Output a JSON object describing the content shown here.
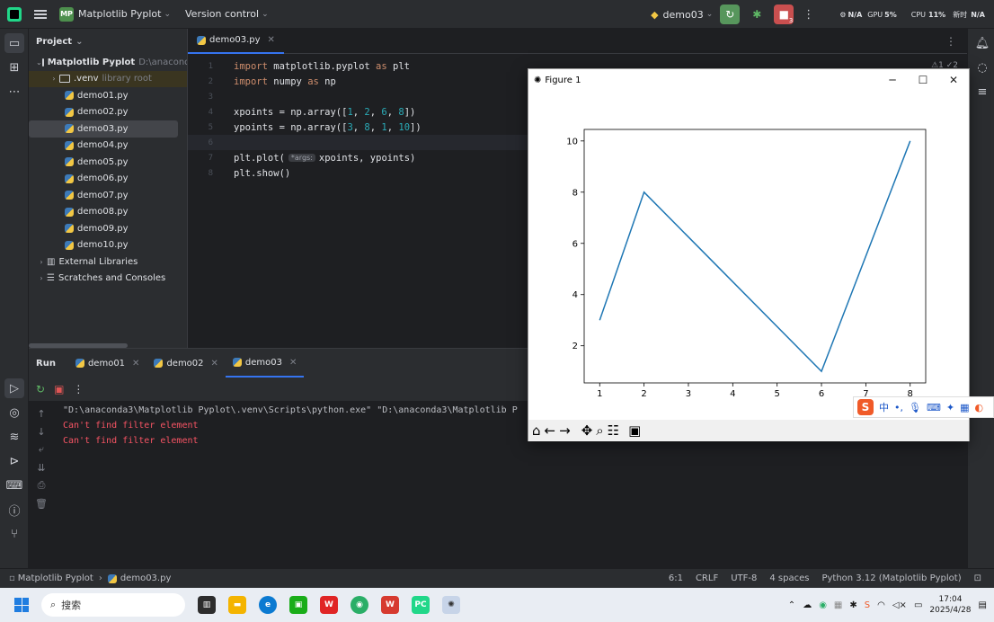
{
  "titlebar": {
    "project_badge": "MP",
    "project_name": "Matplotlib Pyplot",
    "version_control": "Version control",
    "run_config": "demo03",
    "run_badge": "3",
    "gpu": "GPU",
    "gpu_pct": "5%",
    "na1": "N/A",
    "cpu": "CPU",
    "cpu_pct": "11%",
    "net_label": "新时",
    "na2": "N/A"
  },
  "project": {
    "header": "Project",
    "root": {
      "name": "Matplotlib Pyplot",
      "path": "D:\\anacond"
    },
    "venv": {
      "name": ".venv",
      "note": "library root"
    },
    "files": [
      "demo01.py",
      "demo02.py",
      "demo03.py",
      "demo04.py",
      "demo05.py",
      "demo06.py",
      "demo07.py",
      "demo08.py",
      "demo09.py",
      "demo10.py"
    ],
    "selected_index": 2,
    "external": "External Libraries",
    "scratches": "Scratches and Consoles"
  },
  "editor": {
    "tab": "demo03.py",
    "inspect": "⚠1 ✓2",
    "lines": [
      {
        "n": "1",
        "parts": [
          [
            "kw",
            "import"
          ],
          [
            "t",
            " matplotlib.pyplot "
          ],
          [
            "kw",
            "as"
          ],
          [
            "t",
            " plt"
          ]
        ]
      },
      {
        "n": "2",
        "parts": [
          [
            "kw",
            "import"
          ],
          [
            "t",
            " numpy "
          ],
          [
            "kw",
            "as"
          ],
          [
            "t",
            " np"
          ]
        ]
      },
      {
        "n": "3",
        "parts": []
      },
      {
        "n": "4",
        "parts": [
          [
            "t",
            "xpoints = np.array(["
          ],
          [
            "num",
            "1"
          ],
          [
            "t",
            ", "
          ],
          [
            "num",
            "2"
          ],
          [
            "t",
            ", "
          ],
          [
            "num",
            "6"
          ],
          [
            "t",
            ", "
          ],
          [
            "num",
            "8"
          ],
          [
            "t",
            "])"
          ]
        ]
      },
      {
        "n": "5",
        "parts": [
          [
            "t",
            "ypoints = np.array(["
          ],
          [
            "num",
            "3"
          ],
          [
            "t",
            ", "
          ],
          [
            "num",
            "8"
          ],
          [
            "t",
            ", "
          ],
          [
            "num",
            "1"
          ],
          [
            "t",
            ", "
          ],
          [
            "num",
            "10"
          ],
          [
            "t",
            "])"
          ]
        ]
      },
      {
        "n": "6",
        "parts": []
      },
      {
        "n": "7",
        "parts": [
          [
            "t",
            "plt.plot("
          ],
          [
            "hint",
            "*args:"
          ],
          [
            "t",
            "xpoints, ypoints)"
          ]
        ]
      },
      {
        "n": "8",
        "parts": [
          [
            "t",
            "plt.show()"
          ]
        ]
      }
    ]
  },
  "run": {
    "title": "Run",
    "tabs": [
      "demo01",
      "demo02",
      "demo03"
    ],
    "active_tab": 2,
    "console": [
      {
        "kind": "cmd",
        "text": "\"D:\\anaconda3\\Matplotlib Pyplot\\.venv\\Scripts\\python.exe\" \"D:\\anaconda3\\Matplotlib P"
      },
      {
        "kind": "err",
        "text": "Can't find filter element"
      },
      {
        "kind": "err",
        "text": "Can't find filter element"
      }
    ]
  },
  "status": {
    "project": "Matplotlib Pyplot",
    "file": "demo03.py",
    "position": "6:1",
    "line_sep": "CRLF",
    "encoding": "UTF-8",
    "indent": "4 spaces",
    "interpreter": "Python 3.12 (Matplotlib Pyplot)"
  },
  "figure": {
    "title": "Figure 1",
    "toolbar_icons": [
      "home-icon",
      "back-icon",
      "forward-icon",
      "pan-icon",
      "zoom-icon",
      "configure-icon",
      "save-icon"
    ]
  },
  "chart_data": {
    "type": "line",
    "x": [
      1,
      2,
      6,
      8
    ],
    "series": [
      {
        "values": [
          3,
          8,
          1,
          10
        ]
      }
    ],
    "xlim": [
      0.65,
      8.35
    ],
    "ylim": [
      0.55,
      10.45
    ],
    "xticks": [
      "1",
      "2",
      "3",
      "4",
      "5",
      "6",
      "7",
      "8"
    ],
    "yticks": [
      "2",
      "4",
      "6",
      "8",
      "10"
    ],
    "line_color": "#1f77b4",
    "grid": false
  },
  "ime": {
    "logo": "S",
    "lang": "中",
    "punct": "•,"
  },
  "taskbar": {
    "search": "搜索",
    "time": "17:04",
    "date": "2025/4/28"
  }
}
